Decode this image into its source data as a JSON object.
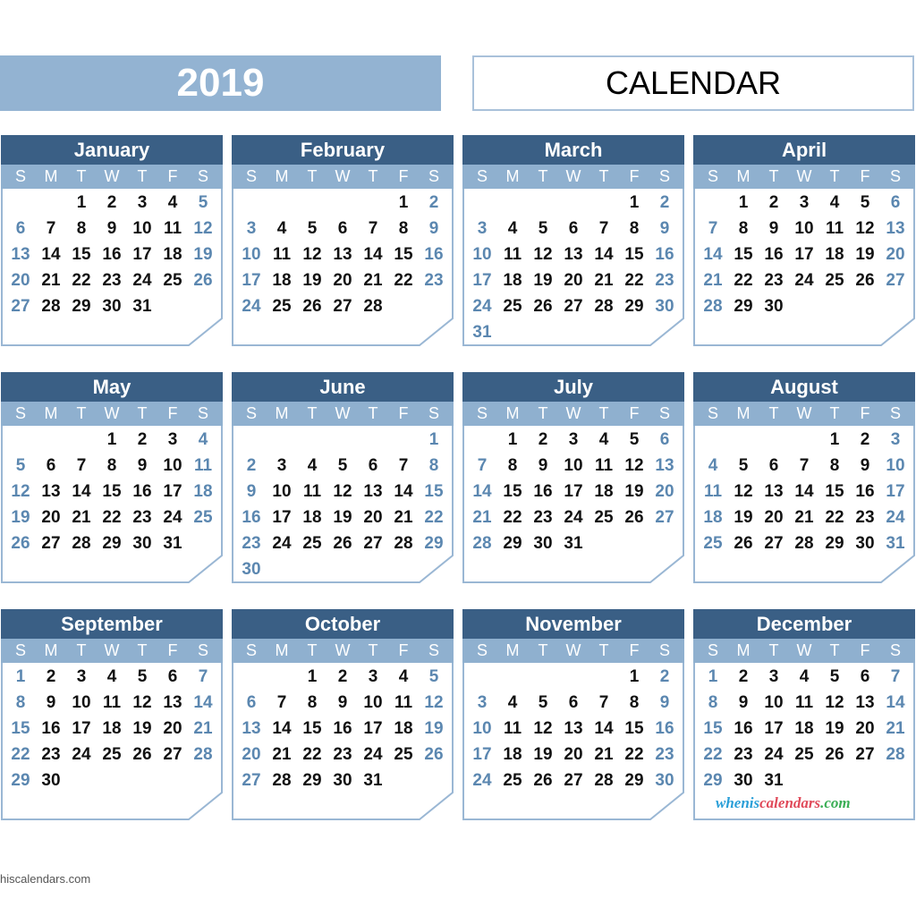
{
  "year": "2019",
  "title": "CALENDAR",
  "weekdays": [
    "S",
    "M",
    "T",
    "W",
    "T",
    "F",
    "S"
  ],
  "colors": {
    "header": "#3a5f85",
    "weekday_bar": "#8fb0cf",
    "banner": "#93b3d2",
    "weekend_text": "#5b87b0"
  },
  "months": [
    {
      "name": "January",
      "weeks": [
        [
          null,
          null,
          1,
          2,
          3,
          4,
          5
        ],
        [
          6,
          7,
          8,
          9,
          10,
          11,
          12
        ],
        [
          13,
          14,
          15,
          16,
          17,
          18,
          19
        ],
        [
          20,
          21,
          22,
          23,
          24,
          25,
          26
        ],
        [
          27,
          28,
          29,
          30,
          31,
          null,
          null
        ]
      ]
    },
    {
      "name": "February",
      "weeks": [
        [
          null,
          null,
          null,
          null,
          null,
          1,
          2
        ],
        [
          3,
          4,
          5,
          6,
          7,
          8,
          9
        ],
        [
          10,
          11,
          12,
          13,
          14,
          15,
          16
        ],
        [
          17,
          18,
          19,
          20,
          21,
          22,
          23
        ],
        [
          24,
          25,
          26,
          27,
          28,
          null,
          null
        ]
      ]
    },
    {
      "name": "March",
      "weeks": [
        [
          null,
          null,
          null,
          null,
          null,
          1,
          2
        ],
        [
          3,
          4,
          5,
          6,
          7,
          8,
          9
        ],
        [
          10,
          11,
          12,
          13,
          14,
          15,
          16
        ],
        [
          17,
          18,
          19,
          20,
          21,
          22,
          23
        ],
        [
          24,
          25,
          26,
          27,
          28,
          29,
          30
        ],
        [
          31,
          null,
          null,
          null,
          null,
          null,
          null
        ]
      ]
    },
    {
      "name": "April",
      "weeks": [
        [
          null,
          1,
          2,
          3,
          4,
          5,
          6
        ],
        [
          7,
          8,
          9,
          10,
          11,
          12,
          13
        ],
        [
          14,
          15,
          16,
          17,
          18,
          19,
          20
        ],
        [
          21,
          22,
          23,
          24,
          25,
          26,
          27
        ],
        [
          28,
          29,
          30,
          null,
          null,
          null,
          null
        ]
      ]
    },
    {
      "name": "May",
      "weeks": [
        [
          null,
          null,
          null,
          1,
          2,
          3,
          4
        ],
        [
          5,
          6,
          7,
          8,
          9,
          10,
          11
        ],
        [
          12,
          13,
          14,
          15,
          16,
          17,
          18
        ],
        [
          19,
          20,
          21,
          22,
          23,
          24,
          25
        ],
        [
          26,
          27,
          28,
          29,
          30,
          31,
          null
        ]
      ]
    },
    {
      "name": "June",
      "weeks": [
        [
          null,
          null,
          null,
          null,
          null,
          null,
          1
        ],
        [
          2,
          3,
          4,
          5,
          6,
          7,
          8
        ],
        [
          9,
          10,
          11,
          12,
          13,
          14,
          15
        ],
        [
          16,
          17,
          18,
          19,
          20,
          21,
          22
        ],
        [
          23,
          24,
          25,
          26,
          27,
          28,
          29
        ],
        [
          30,
          null,
          null,
          null,
          null,
          null,
          null
        ]
      ]
    },
    {
      "name": "July",
      "weeks": [
        [
          null,
          1,
          2,
          3,
          4,
          5,
          6
        ],
        [
          7,
          8,
          9,
          10,
          11,
          12,
          13
        ],
        [
          14,
          15,
          16,
          17,
          18,
          19,
          20
        ],
        [
          21,
          22,
          23,
          24,
          25,
          26,
          27
        ],
        [
          28,
          29,
          30,
          31,
          null,
          null,
          null
        ]
      ]
    },
    {
      "name": "August",
      "weeks": [
        [
          null,
          null,
          null,
          null,
          1,
          2,
          3
        ],
        [
          4,
          5,
          6,
          7,
          8,
          9,
          10
        ],
        [
          11,
          12,
          13,
          14,
          15,
          16,
          17
        ],
        [
          18,
          19,
          20,
          21,
          22,
          23,
          24
        ],
        [
          25,
          26,
          27,
          28,
          29,
          30,
          31
        ]
      ]
    },
    {
      "name": "September",
      "weeks": [
        [
          1,
          2,
          3,
          4,
          5,
          6,
          7
        ],
        [
          8,
          9,
          10,
          11,
          12,
          13,
          14
        ],
        [
          15,
          16,
          17,
          18,
          19,
          20,
          21
        ],
        [
          22,
          23,
          24,
          25,
          26,
          27,
          28
        ],
        [
          29,
          30,
          null,
          null,
          null,
          null,
          null
        ]
      ]
    },
    {
      "name": "October",
      "weeks": [
        [
          null,
          null,
          1,
          2,
          3,
          4,
          5
        ],
        [
          6,
          7,
          8,
          9,
          10,
          11,
          12
        ],
        [
          13,
          14,
          15,
          16,
          17,
          18,
          19
        ],
        [
          20,
          21,
          22,
          23,
          24,
          25,
          26
        ],
        [
          27,
          28,
          29,
          30,
          31,
          null,
          null
        ]
      ]
    },
    {
      "name": "November",
      "weeks": [
        [
          null,
          null,
          null,
          null,
          null,
          1,
          2
        ],
        [
          3,
          4,
          5,
          6,
          7,
          8,
          9
        ],
        [
          10,
          11,
          12,
          13,
          14,
          15,
          16
        ],
        [
          17,
          18,
          19,
          20,
          21,
          22,
          23
        ],
        [
          24,
          25,
          26,
          27,
          28,
          29,
          30
        ]
      ]
    },
    {
      "name": "December",
      "weeks": [
        [
          1,
          2,
          3,
          4,
          5,
          6,
          7
        ],
        [
          8,
          9,
          10,
          11,
          12,
          13,
          14
        ],
        [
          15,
          16,
          17,
          18,
          19,
          20,
          21
        ],
        [
          22,
          23,
          24,
          25,
          26,
          27,
          28
        ],
        [
          29,
          30,
          31,
          null,
          null,
          null,
          null
        ]
      ]
    }
  ],
  "logo": {
    "part1": "whenis",
    "part2": "calendars",
    "part3": ".com"
  },
  "footer": "hiscalendars.com"
}
